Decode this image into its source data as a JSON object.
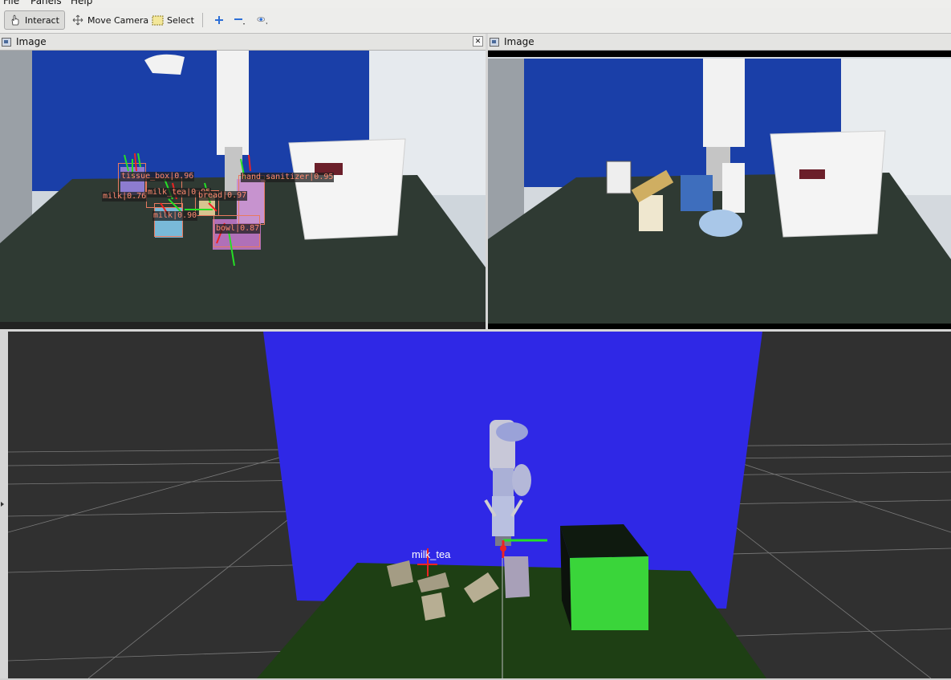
{
  "menubar": {
    "items": [
      "File",
      "Panels",
      "Help"
    ]
  },
  "toolbar": {
    "interact": "Interact",
    "move_camera": "Move Camera",
    "select": "Select"
  },
  "panel_left": {
    "title": "Image",
    "detections": [
      {
        "label": "milk|0.76"
      },
      {
        "label": "tissue_box|0.96"
      },
      {
        "label": "milk_tea|0.95"
      },
      {
        "label": "milk|0.90"
      },
      {
        "label": "bread|0.97"
      },
      {
        "label": "hand_sanitizer|0.95"
      },
      {
        "label": "bowl|0.87"
      }
    ]
  },
  "panel_right": {
    "title": "Image"
  },
  "render3d": {
    "object_label": "milk_tea"
  },
  "colors": {
    "wall": "#2f28e6",
    "table": "#1e3f14",
    "box": "#3ad53a",
    "bg": "#303030"
  }
}
